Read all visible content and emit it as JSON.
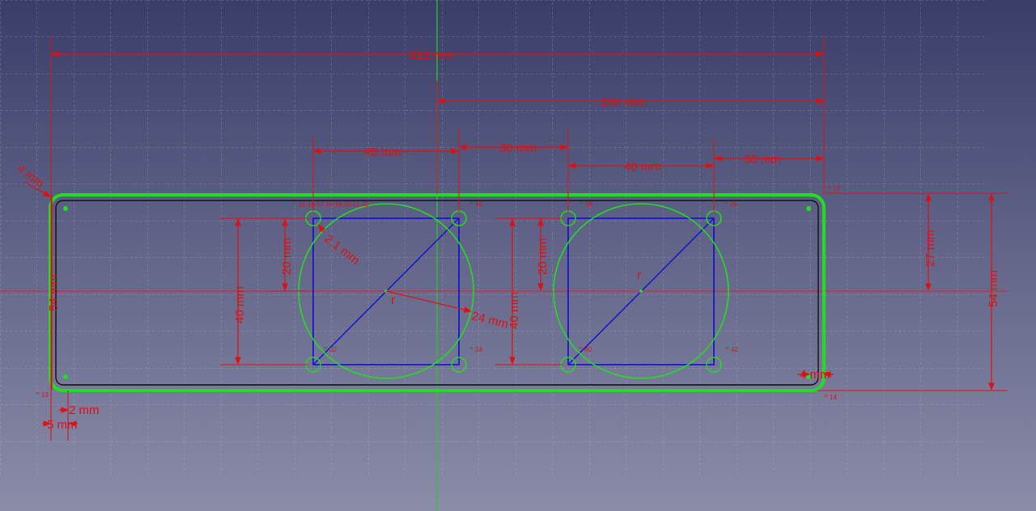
{
  "sketch": {
    "colors": {
      "dimension": "#e01010",
      "construction": "#1010d0",
      "outline": "#22dd22",
      "edge": "#111111",
      "axis_v": "#22cc22",
      "axis_h": "#dd2222",
      "grid": "#c8c8d8"
    },
    "dimensions": {
      "overall_width": "212 mm",
      "half_width": "106 mm",
      "hole_span_left": "40 mm",
      "center_offset": "30 mm",
      "hole_span_right": "40 mm",
      "edge_offset_right": "30 mm",
      "half_height": "27 mm",
      "overall_height_right": "54 mm",
      "overall_height_left": "54 mm",
      "hole_height_left": "40 mm",
      "hole_half_left": "20 mm",
      "hole_half_right": "20 mm",
      "hole_height_right": "40 mm",
      "diameter_radius": "2,1 mm",
      "circle_radius": "24 mm",
      "corner_radius": "4 mm",
      "small_offset_x": "2 mm",
      "small_offset_5": "5 mm",
      "corner_4mm_br": "4 mm",
      "corner_label_tl": "4 mm"
    },
    "labels": {
      "r_left": "r",
      "r_right": "r",
      "c_tl": "=",
      "c_tl_nums": "15 16 17 18 19 20 21 22",
      "c_tr_left": "=",
      "c_tr_left_num": "30",
      "c_tl_right": "=",
      "c_tl_right_num": "38",
      "c_tr_right": "=",
      "c_tr_right_num": "36",
      "c_bl_left": "=",
      "c_bl_left_num": "32",
      "c_br_left": "=",
      "c_br_left_num": "34",
      "c_bl_right": "=",
      "c_bl_right_num": "40",
      "c_br_right": "=",
      "c_br_right_num": "42",
      "c_outer_bl": "=",
      "c_outer_bl_num": "13",
      "c_outer_br": "=",
      "c_outer_br_num": "14",
      "c_outer_tr": "=",
      "c_outer_tr_num": "12"
    }
  }
}
